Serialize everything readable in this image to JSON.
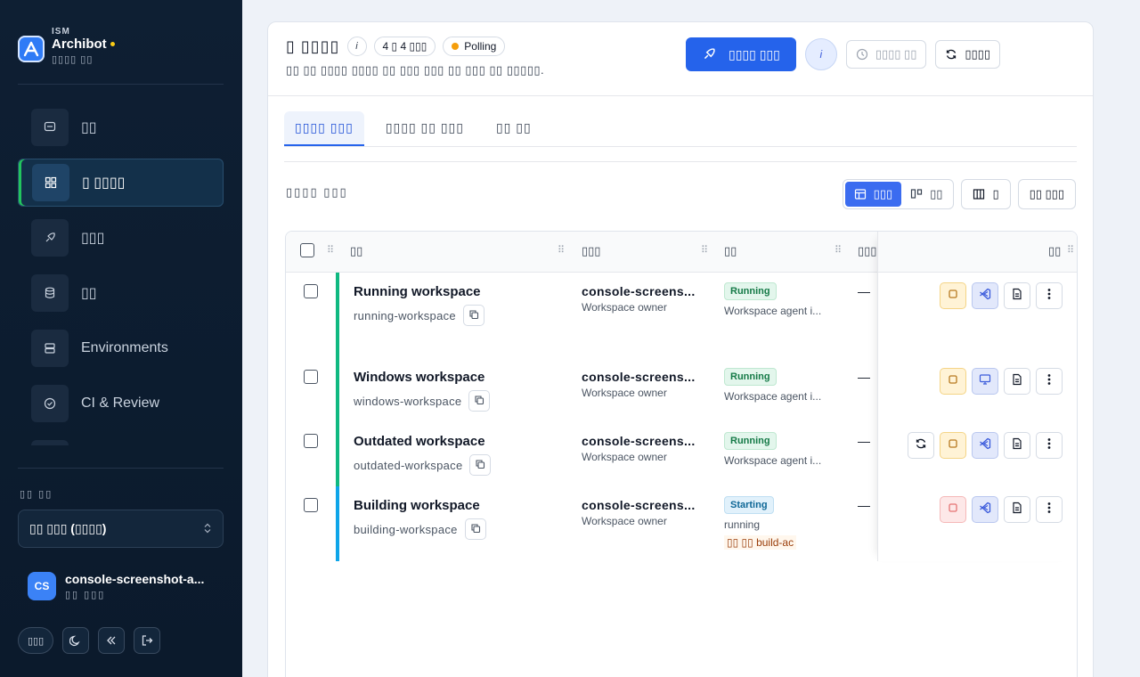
{
  "brand": {
    "kicker": "ISM",
    "name": "Archibot",
    "subtitle": "▯▯▯▯ ▯▯"
  },
  "sidebar": {
    "items": [
      {
        "label": "▯▯",
        "icon": "chat-icon",
        "active": false
      },
      {
        "label": "▯ ▯▯▯▯",
        "icon": "dashboard-icon",
        "active": true
      },
      {
        "label": "▯▯▯",
        "icon": "rocket-icon",
        "active": false
      },
      {
        "label": "▯▯",
        "icon": "database-icon",
        "active": false
      },
      {
        "label": "Environments",
        "icon": "server-icon",
        "active": false
      },
      {
        "label": "CI & Review",
        "icon": "check-circle-icon",
        "active": false
      }
    ],
    "org_label": "▯▯ ▯▯",
    "org_value": "▯▯  ▯▯▯ (▯▯▯▯)",
    "user": {
      "initials": "CS",
      "name": "console-screenshot-a...",
      "role": "▯▯ ▯▯▯"
    },
    "lang_label": "▯▯▯"
  },
  "header": {
    "title": "▯ ▯▯▯▯",
    "info": "i",
    "count_chip": "4 ▯ 4 ▯▯▯",
    "polling_chip": "Polling",
    "subtitle": "▯▯ ▯▯ ▯▯▯▯ ▯▯▯▯ ▯▯ ▯▯▯ ▯▯▯ ▯▯ ▯▯▯ ▯▯ ▯▯▯▯▯.",
    "primary_button": "▯▯▯▯ ▯▯▯",
    "info_button": "i",
    "schedule_button": "▯▯▯▯ ▯▯",
    "refresh_button": "▯▯▯▯"
  },
  "tabs": [
    {
      "label": "▯▯▯▯ ▯▯▯",
      "active": true
    },
    {
      "label": "▯▯▯▯ ▯▯ ▯▯▯",
      "active": false
    },
    {
      "label": "▯▯ ▯▯",
      "active": false
    }
  ],
  "list": {
    "title": "▯▯▯▯ ▯▯▯",
    "view_table": "▯▯▯",
    "view_cards": "▯▯",
    "columns_button": "▯",
    "filter_button": "▯▯ ▯▯▯"
  },
  "table": {
    "columns": [
      "▯▯",
      "▯▯▯",
      "▯▯",
      "▯▯▯",
      "▯▯"
    ],
    "rows": [
      {
        "name": "Running workspace",
        "slug": "running-workspace",
        "owner": "console-screens...",
        "owner_role": "Workspace owner",
        "status": "Running",
        "status_kind": "running",
        "status_detail": "Workspace agent i...",
        "build_tag": "",
        "extra": "—",
        "stripe_color": "#10b981",
        "ide_icon": "vscode-icon"
      },
      {
        "name": "Windows workspace",
        "slug": "windows-workspace",
        "owner": "console-screens...",
        "owner_role": "Workspace owner",
        "status": "Running",
        "status_kind": "running",
        "status_detail": "Workspace agent i...",
        "build_tag": "",
        "extra": "—",
        "stripe_color": "#10b981",
        "ide_icon": "remote-desktop-icon"
      },
      {
        "name": "Outdated workspace",
        "slug": "outdated-workspace",
        "owner": "console-screens...",
        "owner_role": "Workspace owner",
        "status": "Running",
        "status_kind": "running",
        "status_detail": "Workspace agent i...",
        "build_tag": "",
        "extra": "—",
        "stripe_color": "#10b981",
        "ide_icon": "vscode-icon"
      },
      {
        "name": "Building workspace",
        "slug": "building-workspace",
        "owner": "console-screens...",
        "owner_role": "Workspace owner",
        "status": "Starting",
        "status_kind": "starting",
        "status_detail": "running",
        "build_tag": "▯▯ ▯▯ build-ac",
        "extra": "—",
        "stripe_color": "#0ea5e9",
        "ide_icon": "vscode-icon"
      }
    ]
  }
}
